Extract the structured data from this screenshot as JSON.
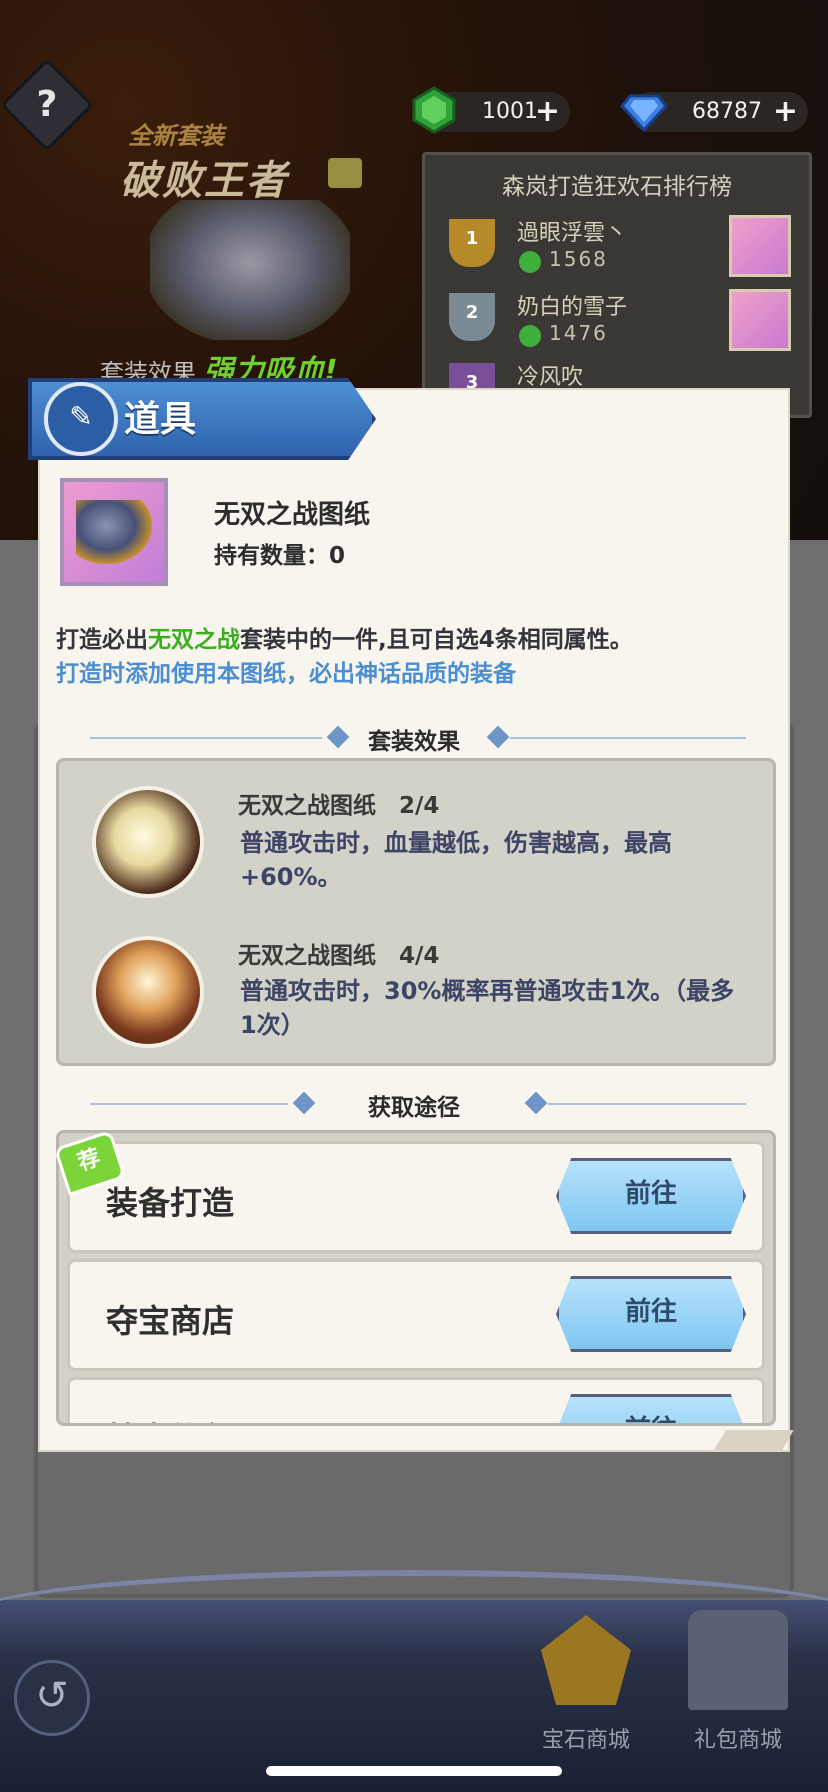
{
  "top_bar": {
    "help_symbol": "?",
    "currencies": [
      {
        "icon": "green-gem-icon",
        "value": "1001",
        "plus": "+"
      },
      {
        "icon": "blue-diamond-icon",
        "value": "68787",
        "plus": "+"
      }
    ]
  },
  "promo": {
    "subtitle": "全新套装",
    "title": "破败王者",
    "effect_label": "套装效果",
    "effect_value": "强力吸血!"
  },
  "leaderboard": {
    "title": "森岚打造狂欢石排行榜",
    "entries": [
      {
        "rank": "1",
        "name": "過眼浮雲丶",
        "score": "1568"
      },
      {
        "rank": "2",
        "name": "奶白的雪子",
        "score": "1476"
      },
      {
        "rank": "3",
        "name": "冷风吹",
        "score": ""
      }
    ]
  },
  "dialog": {
    "header": "道具",
    "item": {
      "name": "无双之战图纸",
      "quantity": "持有数量：0"
    },
    "description": {
      "prefix": "打造必出",
      "highlight": "无双之战",
      "suffix": "套装中的一件,且可自选4条相同属性。",
      "line2": "打造时添加使用本图纸，必出神话品质的装备"
    },
    "set_effects_title": "套装效果",
    "set_effects": [
      {
        "title": "无双之战图纸　2/4",
        "text": "普通攻击时，血量越低，伤害越高，最高+60%。"
      },
      {
        "title": "无双之战图纸　4/4",
        "text": "普通攻击时，30%概率再普通攻击1次。（最多1次）"
      }
    ],
    "sources_title": "获取途径",
    "sources": [
      {
        "label": "装备打造",
        "button": "前往",
        "tag": "荐"
      },
      {
        "label": "夺宝商店",
        "button": "前往"
      },
      {
        "label": "特惠礼包",
        "button": "前往"
      }
    ]
  },
  "bottom_nav": {
    "back_symbol": "↺",
    "items": [
      {
        "label": "宝石商城"
      },
      {
        "label": "礼包商城"
      }
    ]
  },
  "colors": {
    "highlight_green": "#3aae1f",
    "link_blue": "#4b8ed2",
    "header_blue": "#2f62ae",
    "button_blue": "#7fc6f2"
  }
}
